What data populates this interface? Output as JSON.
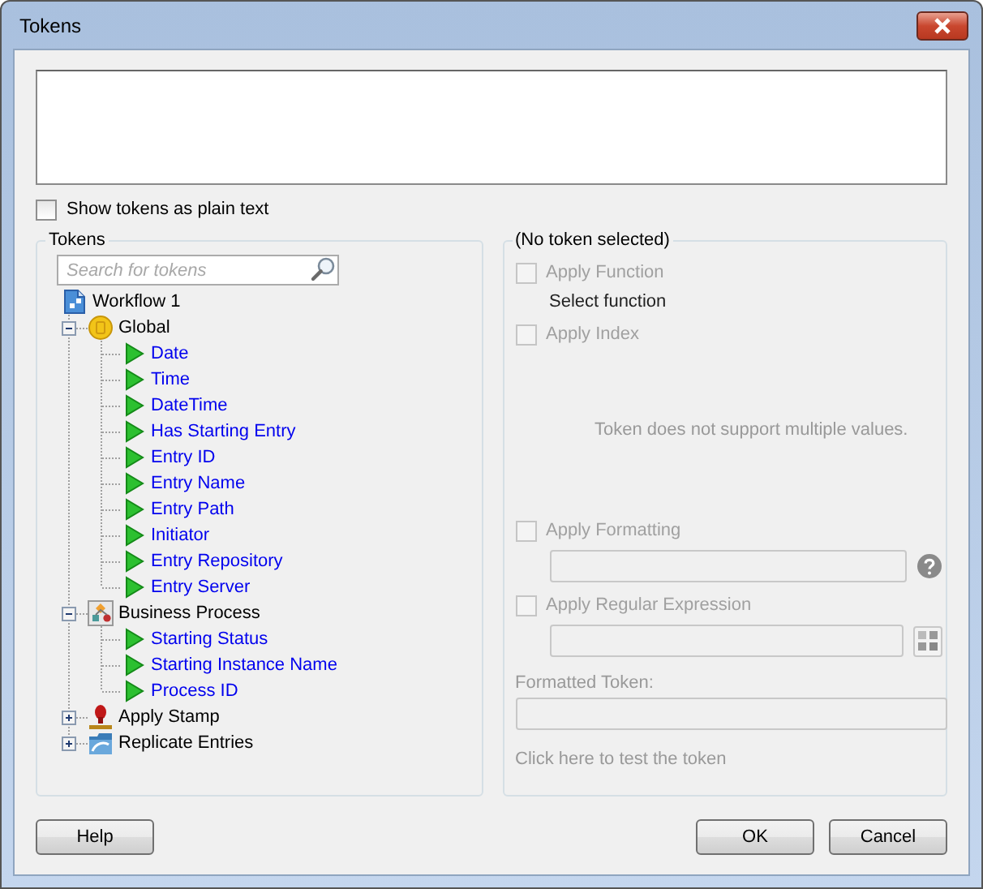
{
  "window": {
    "title": "Tokens"
  },
  "plain_text_option": {
    "label": "Show tokens as plain text",
    "checked": false
  },
  "tokens_panel": {
    "title": "Tokens",
    "search": {
      "placeholder": "Search for tokens"
    },
    "tree": [
      {
        "label": "Workflow 1",
        "kind": "workflow",
        "children": [
          {
            "label": "Global",
            "kind": "global",
            "expanded": true,
            "children": [
              {
                "label": "Date",
                "kind": "token"
              },
              {
                "label": "Time",
                "kind": "token"
              },
              {
                "label": "DateTime",
                "kind": "token"
              },
              {
                "label": "Has Starting Entry",
                "kind": "token"
              },
              {
                "label": "Entry ID",
                "kind": "token"
              },
              {
                "label": "Entry Name",
                "kind": "token"
              },
              {
                "label": "Entry Path",
                "kind": "token"
              },
              {
                "label": "Initiator",
                "kind": "token"
              },
              {
                "label": "Entry Repository",
                "kind": "token"
              },
              {
                "label": "Entry Server",
                "kind": "token"
              }
            ]
          },
          {
            "label": "Business Process",
            "kind": "process",
            "expanded": true,
            "children": [
              {
                "label": "Starting Status",
                "kind": "token"
              },
              {
                "label": "Starting Instance Name",
                "kind": "token"
              },
              {
                "label": "Process ID",
                "kind": "token"
              }
            ]
          },
          {
            "label": "Apply Stamp",
            "kind": "stamp",
            "expanded": false
          },
          {
            "label": "Replicate Entries",
            "kind": "replicate",
            "expanded": false
          }
        ]
      }
    ]
  },
  "options_panel": {
    "title": "(No token selected)",
    "apply_function": {
      "label": "Apply Function",
      "checked": false,
      "disabled": true
    },
    "function_label": "Select function",
    "apply_index": {
      "label": "Apply Index",
      "checked": false,
      "disabled": true
    },
    "index_note": "Token does not support multiple values.",
    "apply_formatting": {
      "label": "Apply Formatting",
      "checked": false,
      "disabled": true
    },
    "apply_regex": {
      "label": "Apply Regular Expression",
      "checked": false,
      "disabled": true
    },
    "formatted_token_label": "Formatted Token:",
    "test_link": "Click here to test the token"
  },
  "buttons": [
    {
      "label": "Help",
      "kind": "left"
    },
    {
      "label": "OK",
      "kind": "right"
    },
    {
      "label": "Cancel",
      "kind": "right"
    }
  ]
}
